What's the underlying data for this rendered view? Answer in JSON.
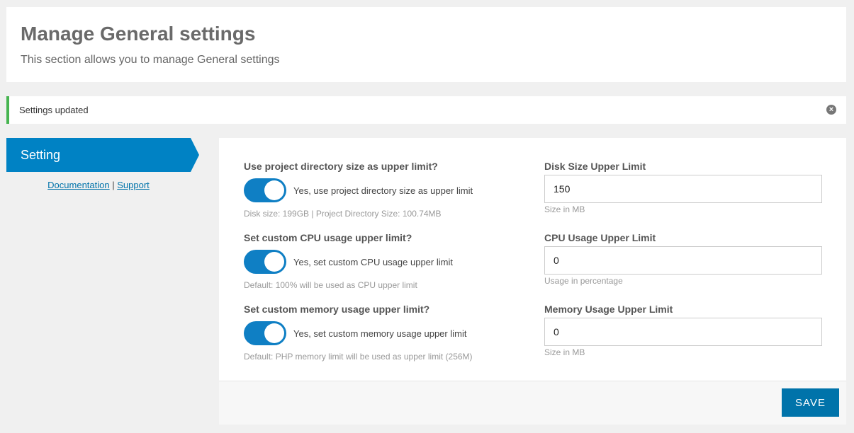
{
  "header": {
    "title": "Manage General settings",
    "subtitle": "This section allows you to manage General settings"
  },
  "notice": {
    "message": "Settings updated",
    "close_icon": "close-circle-icon",
    "accent_color": "#46b450"
  },
  "sidebar": {
    "active_tab": "Setting",
    "links": {
      "documentation": "Documentation",
      "separator": "|",
      "support": "Support"
    },
    "accent_color": "#0082c4"
  },
  "settings": [
    {
      "question": "Use project directory size as upper limit?",
      "toggle_label": "Yes, use project directory size as upper limit",
      "toggle_on": true,
      "hint": "Disk size: 199GB | Project Directory Size: 100.74MB",
      "field_label": "Disk Size Upper Limit",
      "field_value": "150",
      "field_hint": "Size in MB"
    },
    {
      "question": "Set custom CPU usage upper limit?",
      "toggle_label": "Yes, set custom CPU usage upper limit",
      "toggle_on": true,
      "hint": "Default: 100% will be used as CPU upper limit",
      "field_label": "CPU Usage Upper Limit",
      "field_value": "0",
      "field_hint": "Usage in percentage"
    },
    {
      "question": "Set custom memory usage upper limit?",
      "toggle_label": "Yes, set custom memory usage upper limit",
      "toggle_on": true,
      "hint": "Default: PHP memory limit will be used as upper limit (256M)",
      "field_label": "Memory Usage Upper Limit",
      "field_value": "0",
      "field_hint": "Size in MB"
    }
  ],
  "footer": {
    "save_label": "SAVE",
    "button_color": "#0073aa"
  }
}
